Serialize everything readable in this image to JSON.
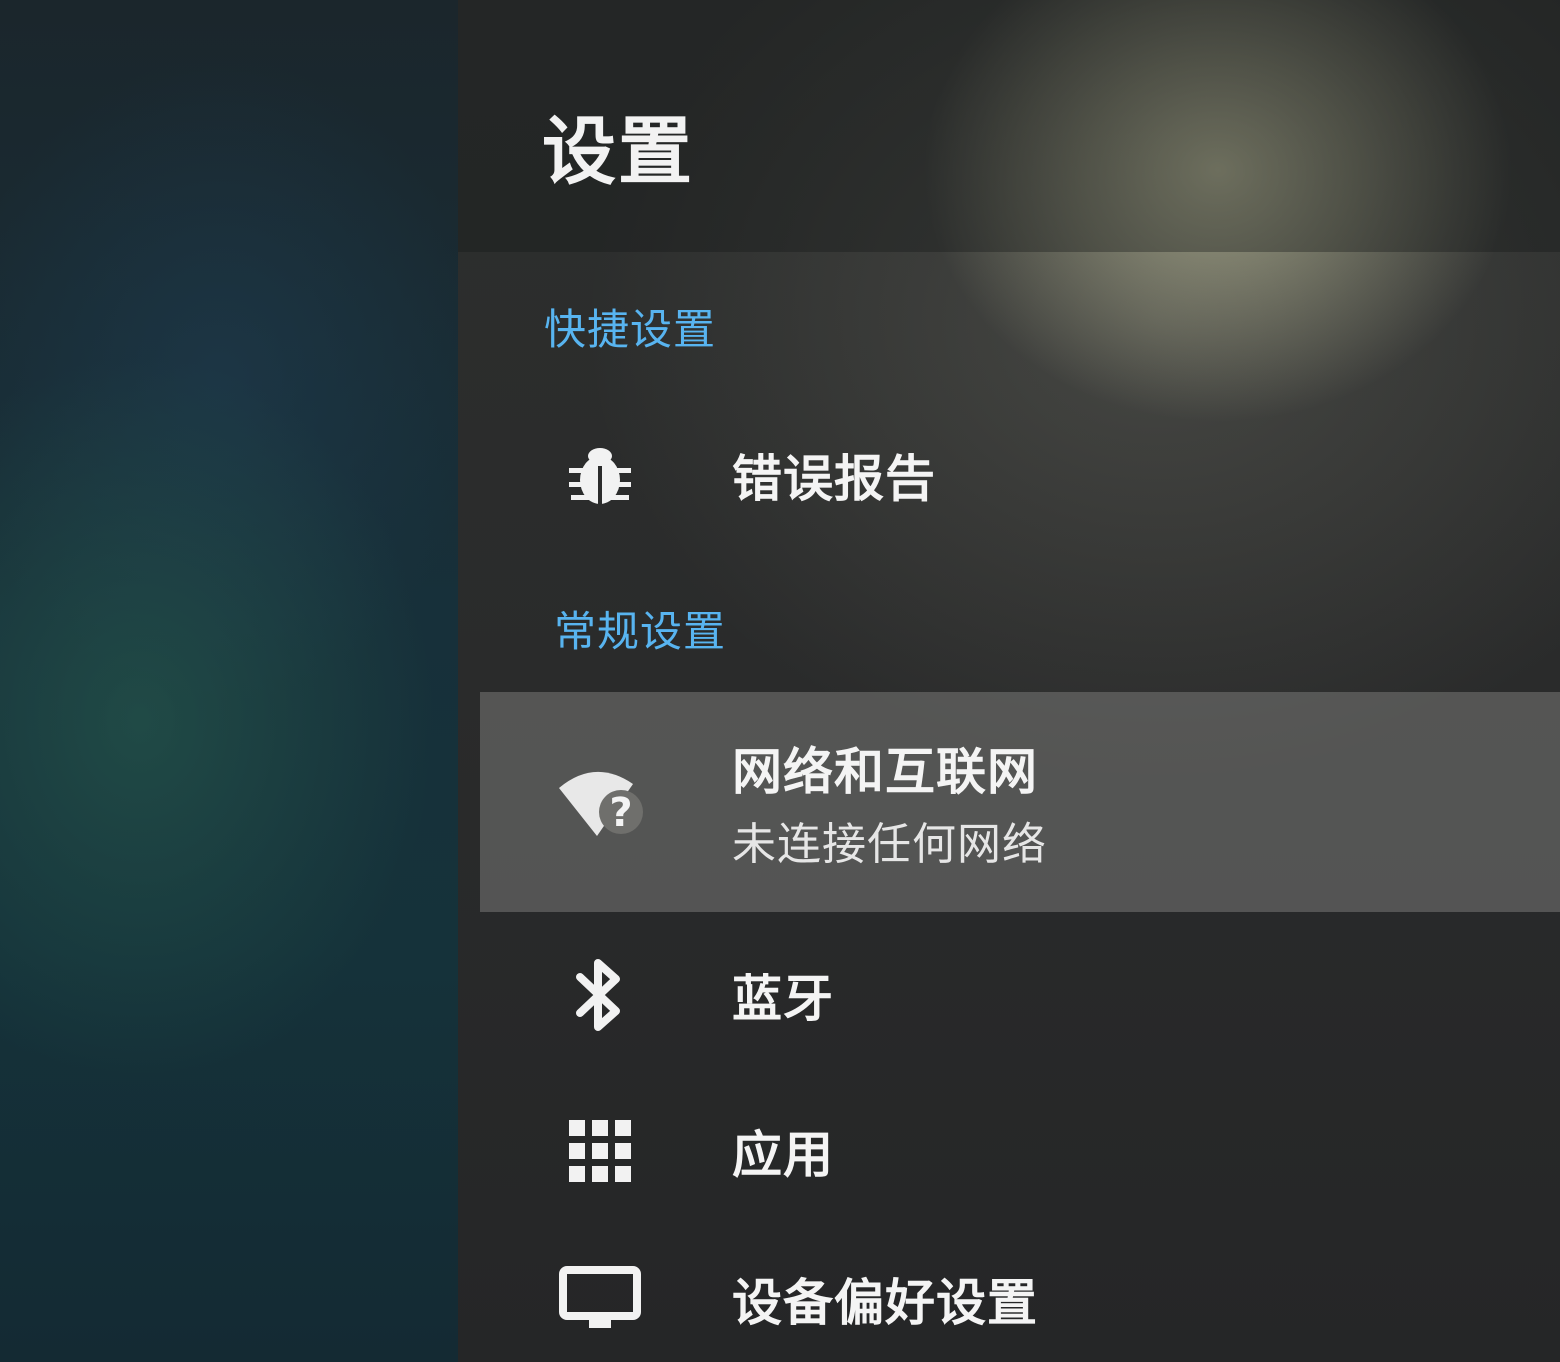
{
  "settings": {
    "title": "设置",
    "sections": {
      "quick": {
        "label": "快捷设置"
      },
      "general": {
        "label": "常规设置"
      }
    },
    "items": {
      "bug_report": {
        "label": "错误报告",
        "icon": "bug-icon"
      },
      "network": {
        "label": "网络和互联网",
        "status": "未连接任何网络",
        "icon": "wifi-unknown-icon"
      },
      "bluetooth": {
        "label": "蓝牙",
        "icon": "bluetooth-icon"
      },
      "apps": {
        "label": "应用",
        "icon": "apps-grid-icon"
      },
      "device_prefs": {
        "label": "设备偏好设置",
        "icon": "display-icon"
      }
    },
    "colors": {
      "accent": "#58b4f0",
      "text": "#f4f4f4",
      "selected_bg": "#6f6f6c"
    }
  }
}
